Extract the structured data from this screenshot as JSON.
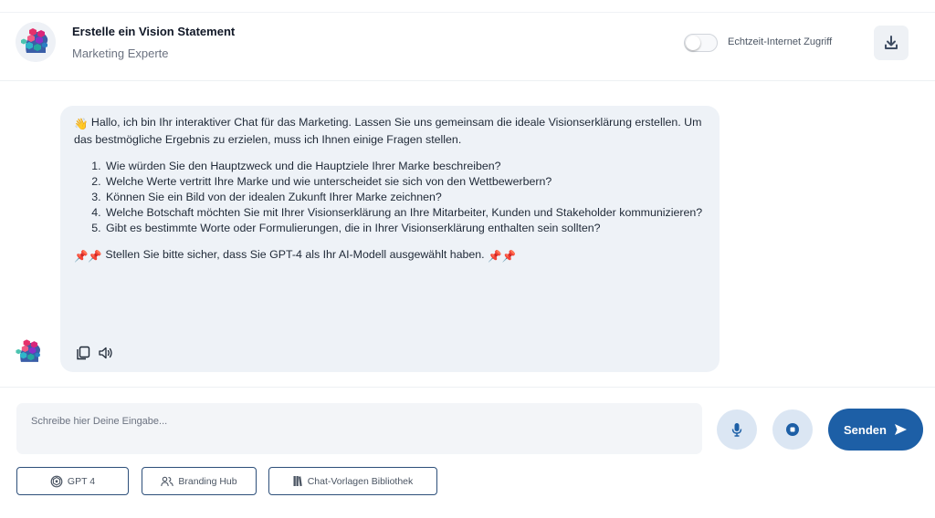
{
  "header": {
    "title": "Erstelle ein Vision Statement",
    "subtitle": "Marketing Experte",
    "toggle_label": "Echtzeit-Internet Zugriff",
    "toggle_on": false,
    "download_icon": "download-icon"
  },
  "message": {
    "wave_emoji": "👋",
    "intro": "Hallo, ich bin Ihr interaktiver Chat für das Marketing. Lassen Sie uns gemeinsam die ideale Visionserklärung erstellen. Um das bestmögliche Ergebnis zu erzielen, muss ich Ihnen einige Fragen stellen.",
    "questions": [
      "Wie würden Sie den Hauptzweck und die Hauptziele Ihrer Marke beschreiben?",
      "Welche Werte vertritt Ihre Marke und wie unterscheidet sie sich von den Wettbewerbern?",
      "Können Sie ein Bild von der idealen Zukunft Ihrer Marke zeichnen?",
      "Welche Botschaft möchten Sie mit Ihrer Visionserklärung an Ihre Mitarbeiter, Kunden und Stakeholder kommunizieren?",
      "Gibt es bestimmte Worte oder Formulierungen, die in Ihrer Visionserklärung enthalten sein sollten?"
    ],
    "pin_emoji": "📌📌",
    "note": "Stellen Sie bitte sicher, dass Sie GPT-4 als Ihr AI-Modell ausgewählt haben.",
    "actions": [
      "copy-icon",
      "speaker-icon"
    ]
  },
  "input": {
    "placeholder": "Schreibe hier Deine Eingabe...",
    "value": ""
  },
  "buttons": {
    "send_label": "Senden",
    "mic_icon": "microphone-icon",
    "stop_icon": "stop-icon"
  },
  "chips": {
    "gpt": "GPT 4",
    "branding": "Branding Hub",
    "library": "Chat-Vorlagen Bibliothek"
  },
  "colors": {
    "accent": "#1d5fa6",
    "bubble_bg": "#eef2f7",
    "round_button_bg": "#dbe6f3",
    "chip_border": "#2d4f7a"
  }
}
